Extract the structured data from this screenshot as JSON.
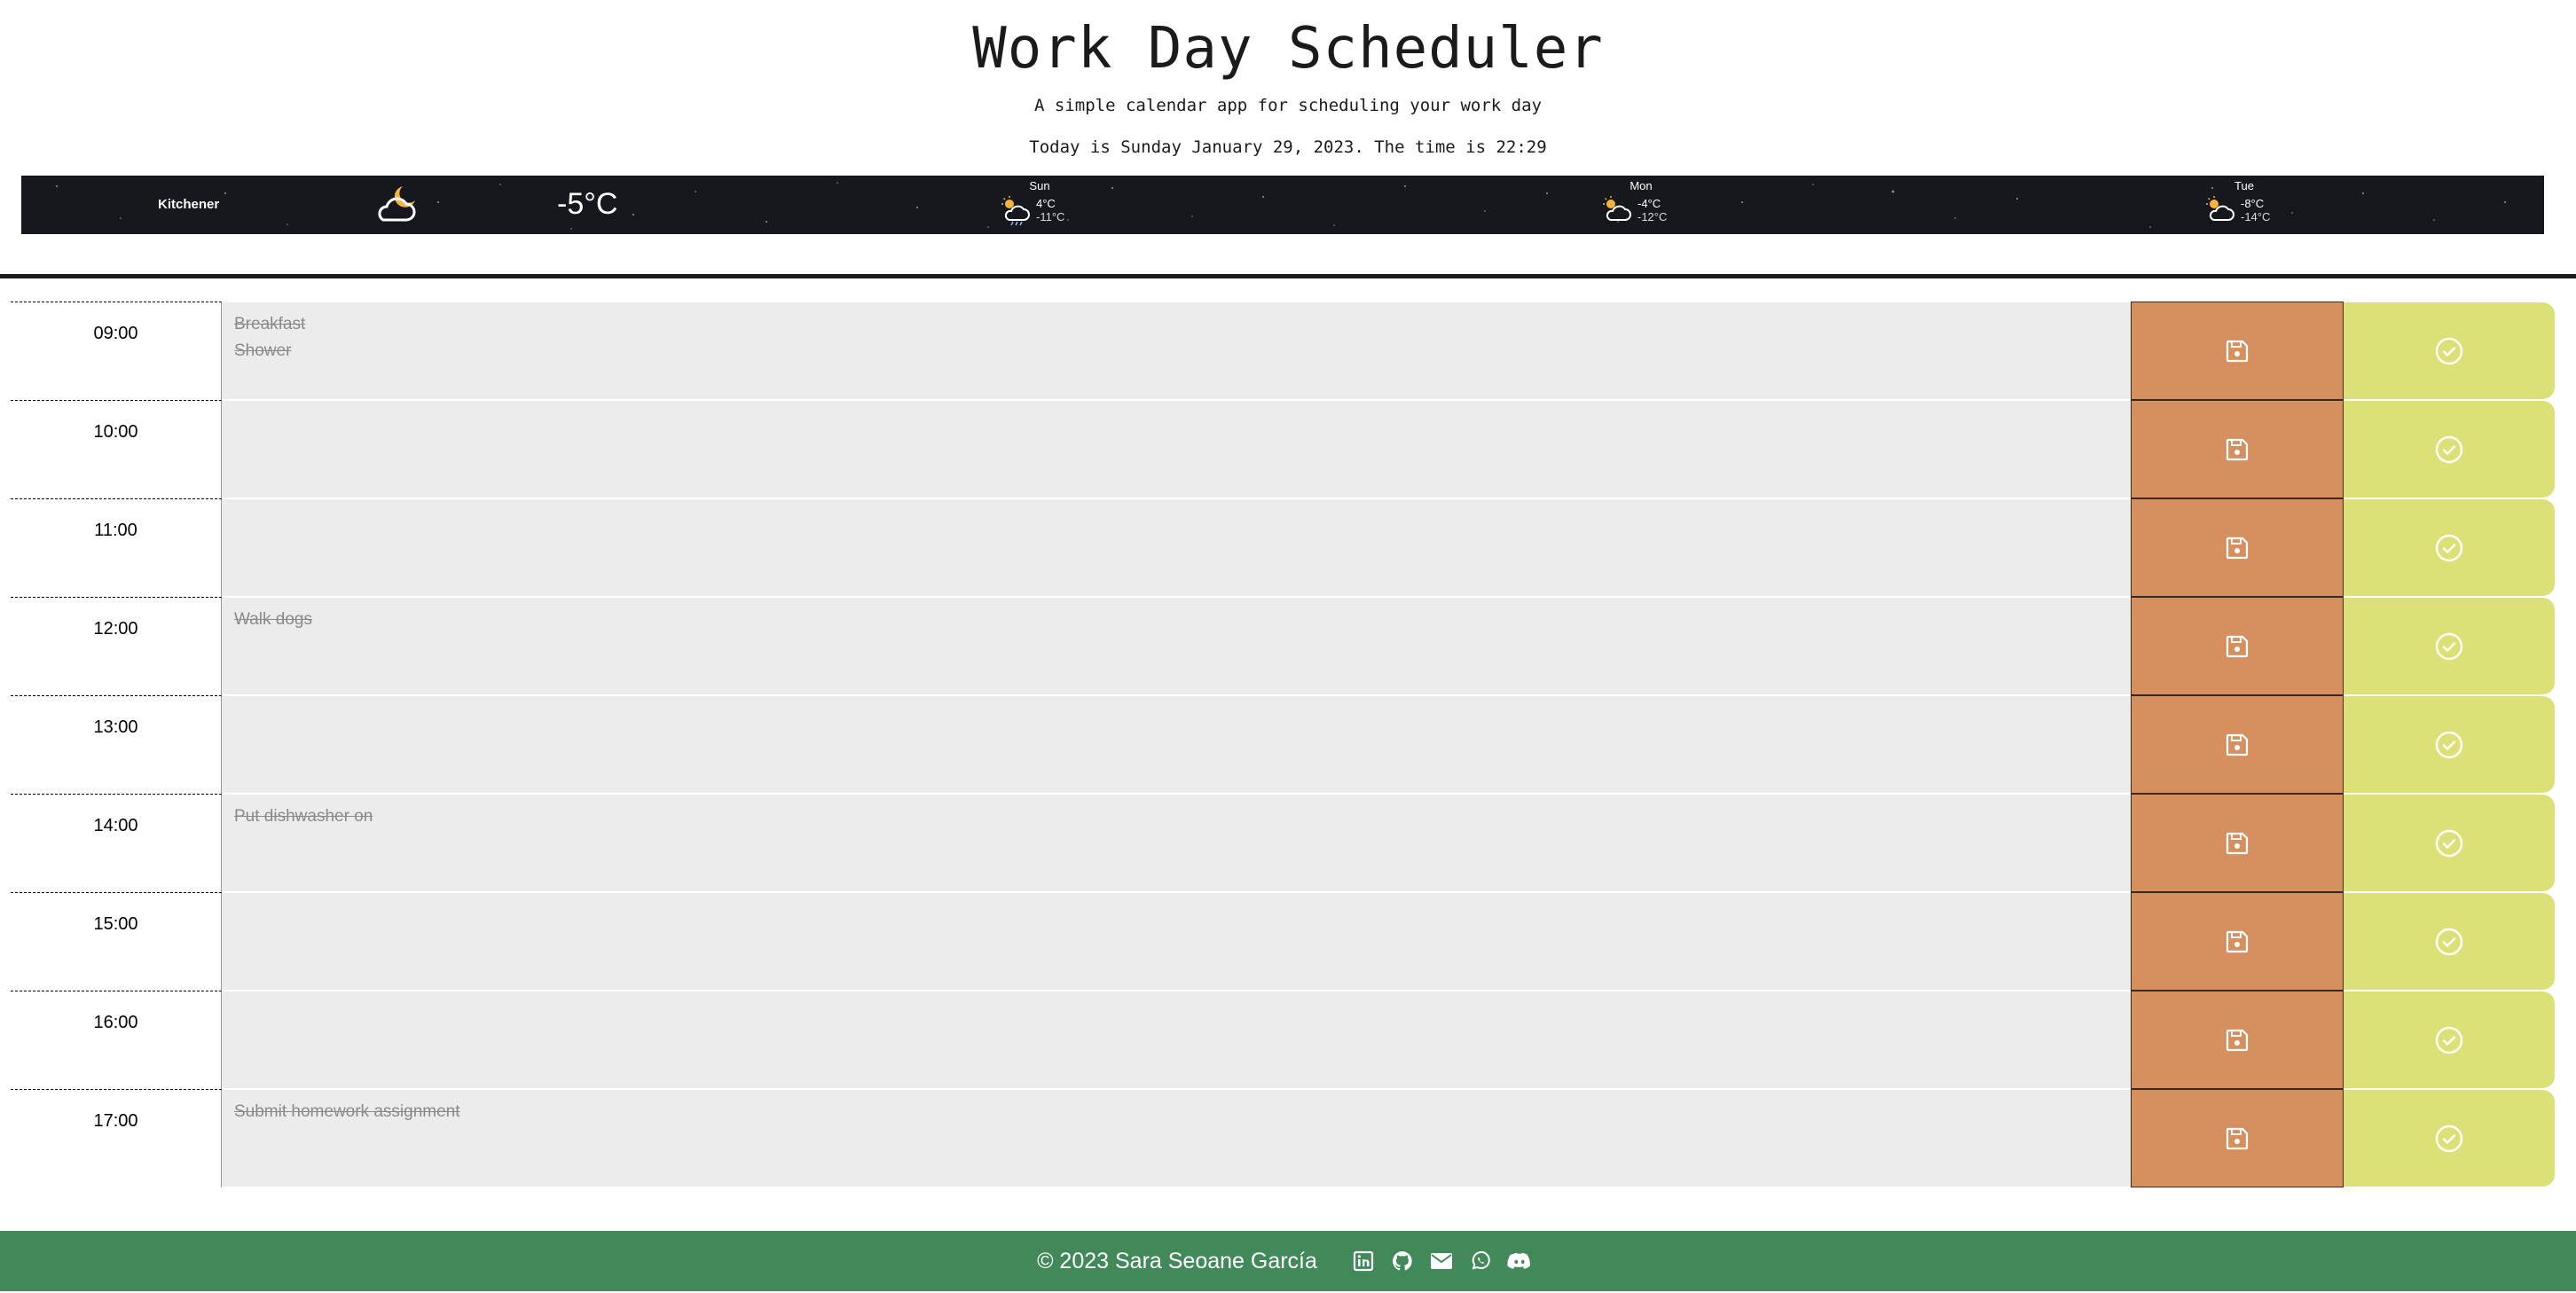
{
  "header": {
    "title": "Work Day Scheduler",
    "lead": "A simple calendar app for scheduling your work day",
    "current_day": "Today is Sunday January 29, 2023. The time is 22:29"
  },
  "weather": {
    "city": "Kitchener",
    "current_temp": "-5°C",
    "current_icon": "partly-cloudy-night-icon",
    "forecast": [
      {
        "day": "Sun",
        "high": "4°C",
        "low": "-11°C",
        "icon": "partly-cloudy-rain-icon"
      },
      {
        "day": "Mon",
        "high": "-4°C",
        "low": "-12°C",
        "icon": "partly-cloudy-day-icon"
      },
      {
        "day": "Tue",
        "high": "-8°C",
        "low": "-14°C",
        "icon": "partly-cloudy-day-icon"
      }
    ]
  },
  "schedule": [
    {
      "hour": "09:00",
      "text": "Breakfast\nShower"
    },
    {
      "hour": "10:00",
      "text": ""
    },
    {
      "hour": "11:00",
      "text": ""
    },
    {
      "hour": "12:00",
      "text": "Walk dogs"
    },
    {
      "hour": "13:00",
      "text": ""
    },
    {
      "hour": "14:00",
      "text": "Put dishwasher on"
    },
    {
      "hour": "15:00",
      "text": ""
    },
    {
      "hour": "16:00",
      "text": ""
    },
    {
      "hour": "17:00",
      "text": "Submit homework assignment"
    }
  ],
  "buttons": {
    "save_icon": "floppy-disk-icon",
    "done_icon": "check-circle-icon"
  },
  "footer": {
    "copyright": "© 2023 Sara Seoane García",
    "social_icons": [
      "linkedin-icon",
      "github-icon",
      "email-icon",
      "whatsapp-icon",
      "discord-icon"
    ]
  },
  "colors": {
    "save": "#d6905f",
    "done": "#dbe176",
    "description_bg": "#ececec",
    "footer": "#418959",
    "weather_bg": "#16181d"
  }
}
